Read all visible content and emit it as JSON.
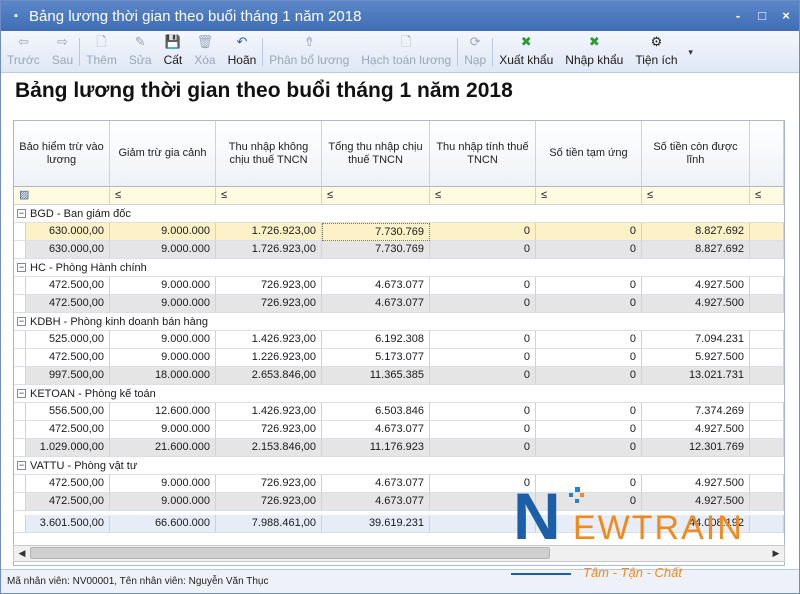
{
  "window": {
    "title": "Bảng lương thời gian theo buổi tháng 1 năm 2018",
    "controls": [
      "-",
      "□",
      "×"
    ]
  },
  "toolbar": {
    "buttons": [
      {
        "label": "Trước",
        "icon": "back-arrow-icon",
        "glyph": "⇦",
        "enabled": false
      },
      {
        "label": "Sau",
        "icon": "forward-arrow-icon",
        "glyph": "⇨",
        "enabled": false
      },
      {
        "label": "Thêm",
        "icon": "add-document-icon",
        "glyph": "🗋",
        "enabled": false
      },
      {
        "label": "Sửa",
        "icon": "edit-document-icon",
        "glyph": "✎",
        "enabled": false
      },
      {
        "label": "Cất",
        "icon": "save-disk-icon",
        "glyph": "💾",
        "enabled": true
      },
      {
        "label": "Xóa",
        "icon": "delete-document-icon",
        "glyph": "🗑",
        "enabled": false
      },
      {
        "label": "Hoãn",
        "icon": "undo-icon",
        "glyph": "↶",
        "enabled": true
      },
      {
        "label": "Phân bổ lương",
        "icon": "allocate-icon",
        "glyph": "⇮",
        "enabled": false
      },
      {
        "label": "Hạch toán lương",
        "icon": "accounting-icon",
        "glyph": "🗋",
        "enabled": false
      },
      {
        "label": "Nạp",
        "icon": "reload-icon",
        "glyph": "⟳",
        "enabled": false
      },
      {
        "label": "Xuất khẩu",
        "icon": "excel-export-icon",
        "glyph": "✖",
        "enabled": true
      },
      {
        "label": "Nhập khẩu",
        "icon": "excel-import-icon",
        "glyph": "✖",
        "enabled": true
      },
      {
        "label": "Tiện ích",
        "icon": "utilities-icon",
        "glyph": "⚙",
        "enabled": true
      }
    ]
  },
  "report_title": "Bảng lương thời gian theo buổi tháng 1 năm 2018",
  "grid": {
    "columns": [
      "Bảo hiểm trừ vào lương",
      "Giảm trừ gia cảnh",
      "Thu nhập không chịu thuế TNCN",
      "Tổng thu nhập chịu thuế TNCN",
      "Thu nhập tính thuế TNCN",
      "Số tiền tạm ứng",
      "Số tiền còn được lĩnh",
      ""
    ],
    "filter_symbol": "≤",
    "groups": [
      {
        "label": "BGD - Ban giám đốc",
        "rows": [
          [
            "630.000,00",
            "9.000.000",
            "1.726.923,00",
            "7.730.769",
            "0",
            "0",
            "8.827.692"
          ]
        ],
        "subtotal": [
          "630.000,00",
          "9.000.000",
          "1.726.923,00",
          "7.730.769",
          "0",
          "0",
          "8.827.692"
        ]
      },
      {
        "label": "HC - Phòng Hành chính",
        "rows": [
          [
            "472.500,00",
            "9.000.000",
            "726.923,00",
            "4.673.077",
            "0",
            "0",
            "4.927.500"
          ]
        ],
        "subtotal": [
          "472.500,00",
          "9.000.000",
          "726.923,00",
          "4.673.077",
          "0",
          "0",
          "4.927.500"
        ]
      },
      {
        "label": "KDBH - Phòng kinh doanh bán hàng",
        "rows": [
          [
            "525.000,00",
            "9.000.000",
            "1.426.923,00",
            "6.192.308",
            "0",
            "0",
            "7.094.231"
          ],
          [
            "472.500,00",
            "9.000.000",
            "1.226.923,00",
            "5.173.077",
            "0",
            "0",
            "5.927.500"
          ]
        ],
        "subtotal": [
          "997.500,00",
          "18.000.000",
          "2.653.846,00",
          "11.365.385",
          "0",
          "0",
          "13.021.731"
        ]
      },
      {
        "label": "KETOAN - Phòng kế toán",
        "rows": [
          [
            "556.500,00",
            "12.600.000",
            "1.426.923,00",
            "6.503.846",
            "0",
            "0",
            "7.374.269"
          ],
          [
            "472.500,00",
            "9.000.000",
            "726.923,00",
            "4.673.077",
            "0",
            "0",
            "4.927.500"
          ]
        ],
        "subtotal": [
          "1.029.000,00",
          "21.600.000",
          "2.153.846,00",
          "11.176.923",
          "0",
          "0",
          "12.301.769"
        ]
      },
      {
        "label": "VATTU - Phòng vật tư",
        "rows": [
          [
            "472.500,00",
            "9.000.000",
            "726.923,00",
            "4.673.077",
            "0",
            "0",
            "4.927.500"
          ]
        ],
        "subtotal": [
          "472.500,00",
          "9.000.000",
          "726.923,00",
          "4.673.077",
          "0",
          "0",
          "4.927.500"
        ]
      }
    ],
    "total": [
      "3.601.500,00",
      "66.600.000",
      "7.988.461,00",
      "39.619.231",
      "",
      "",
      "44.008.192"
    ]
  },
  "statusbar": {
    "text": "Mã nhân viên: NV00001, Tên nhân viên: Nguyễn Văn Thục"
  },
  "watermark": {
    "brand_first": "N",
    "brand_rest": "EWTRAIN",
    "tagline": "Tâm - Tận - Chất"
  }
}
